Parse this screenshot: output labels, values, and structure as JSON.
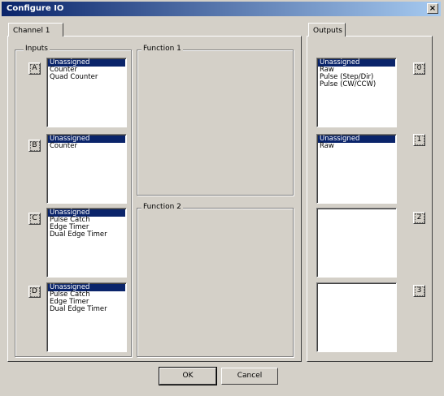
{
  "window": {
    "title": "Configure IO",
    "close": "×"
  },
  "tabs": {
    "left": "Channel 1",
    "right": "Outputs"
  },
  "groups": {
    "inputs": "Inputs",
    "function1": "Function 1",
    "function2": "Function 2"
  },
  "inputs": [
    {
      "button": "A",
      "items": [
        {
          "text": "Unassigned",
          "selected": true
        },
        {
          "text": "Counter"
        },
        {
          "text": "Quad Counter"
        }
      ]
    },
    {
      "button": "B",
      "items": [
        {
          "text": "Unassigned",
          "selected": true
        },
        {
          "text": "Counter"
        }
      ]
    },
    {
      "button": "C",
      "items": [
        {
          "text": "Unassigned",
          "selected": true
        },
        {
          "text": "Pulse Catch"
        },
        {
          "text": "Edge Timer"
        },
        {
          "text": "Dual Edge Timer"
        }
      ]
    },
    {
      "button": "D",
      "items": [
        {
          "text": "Unassigned",
          "selected": true
        },
        {
          "text": "Pulse Catch"
        },
        {
          "text": "Edge Timer"
        },
        {
          "text": "Dual Edge Timer"
        }
      ]
    }
  ],
  "outputs": [
    {
      "button": "0",
      "items": [
        {
          "text": "Unassigned",
          "selected": true
        },
        {
          "text": "Raw"
        },
        {
          "text": "Pulse (Step/Dir)"
        },
        {
          "text": "Pulse (CW/CCW)"
        }
      ]
    },
    {
      "button": "1",
      "items": [
        {
          "text": "Unassigned",
          "selected": true
        },
        {
          "text": "Raw"
        }
      ]
    },
    {
      "button": "2",
      "items": []
    },
    {
      "button": "3",
      "items": []
    }
  ],
  "footer": {
    "ok": "OK",
    "cancel": "Cancel"
  },
  "colors": {
    "face": "#d4d0c8",
    "selection": "#0a246a",
    "title_start": "#0a246a",
    "title_end": "#a6caf0"
  }
}
